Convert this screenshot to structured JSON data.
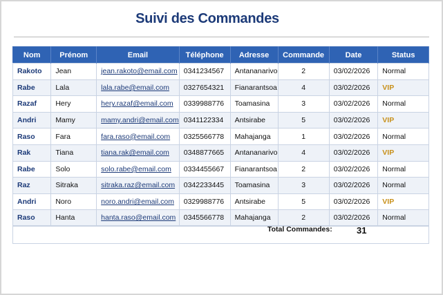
{
  "title": "Suivi des Commandes",
  "columns": [
    "Nom",
    "Prénom",
    "Email",
    "Téléphone",
    "Adresse",
    "Commande",
    "Date",
    "Status"
  ],
  "rows": [
    [
      "Rakoto",
      "Jean",
      "jean.rakoto@email.com",
      "0341234567",
      "Antananarivo",
      "2",
      "03/02/2026",
      "Normal"
    ],
    [
      "Rabe",
      "Lala",
      "lala.rabe@email.com",
      "0327654321",
      "Fianarantsoa",
      "4",
      "03/02/2026",
      "VIP"
    ],
    [
      "Razaf",
      "Hery",
      "hery.razaf@email.com",
      "0339988776",
      "Toamasina",
      "3",
      "03/02/2026",
      "Normal"
    ],
    [
      "Andri",
      "Mamy",
      "mamy.andri@email.com",
      "0341122334",
      "Antsirabe",
      "5",
      "03/02/2026",
      "VIP"
    ],
    [
      "Raso",
      "Fara",
      "fara.raso@email.com",
      "0325566778",
      "Mahajanga",
      "1",
      "03/02/2026",
      "Normal"
    ],
    [
      "Rak",
      "Tiana",
      "tiana.rak@email.com",
      "0348877665",
      "Antananarivo",
      "4",
      "03/02/2026",
      "VIP"
    ],
    [
      "Rabe",
      "Solo",
      "solo.rabe@email.com",
      "0334455667",
      "Fianarantsoa",
      "2",
      "03/02/2026",
      "Normal"
    ],
    [
      "Raz",
      "Sitraka",
      "sitraka.raz@email.com",
      "0342233445",
      "Toamasina",
      "3",
      "03/02/2026",
      "Normal"
    ],
    [
      "Andri",
      "Noro",
      "noro.andri@email.com",
      "0329988776",
      "Antsirabe",
      "5",
      "03/02/2026",
      "VIP"
    ],
    [
      "Raso",
      "Hanta",
      "hanta.raso@email.com",
      "0345566778",
      "Mahajanga",
      "2",
      "03/02/2026",
      "Normal"
    ]
  ],
  "total": {
    "label": "Total Commandes:",
    "value": "31"
  },
  "colors": {
    "header": "#2f63b4",
    "title": "#1c3a78",
    "vip": "#c8901a"
  }
}
